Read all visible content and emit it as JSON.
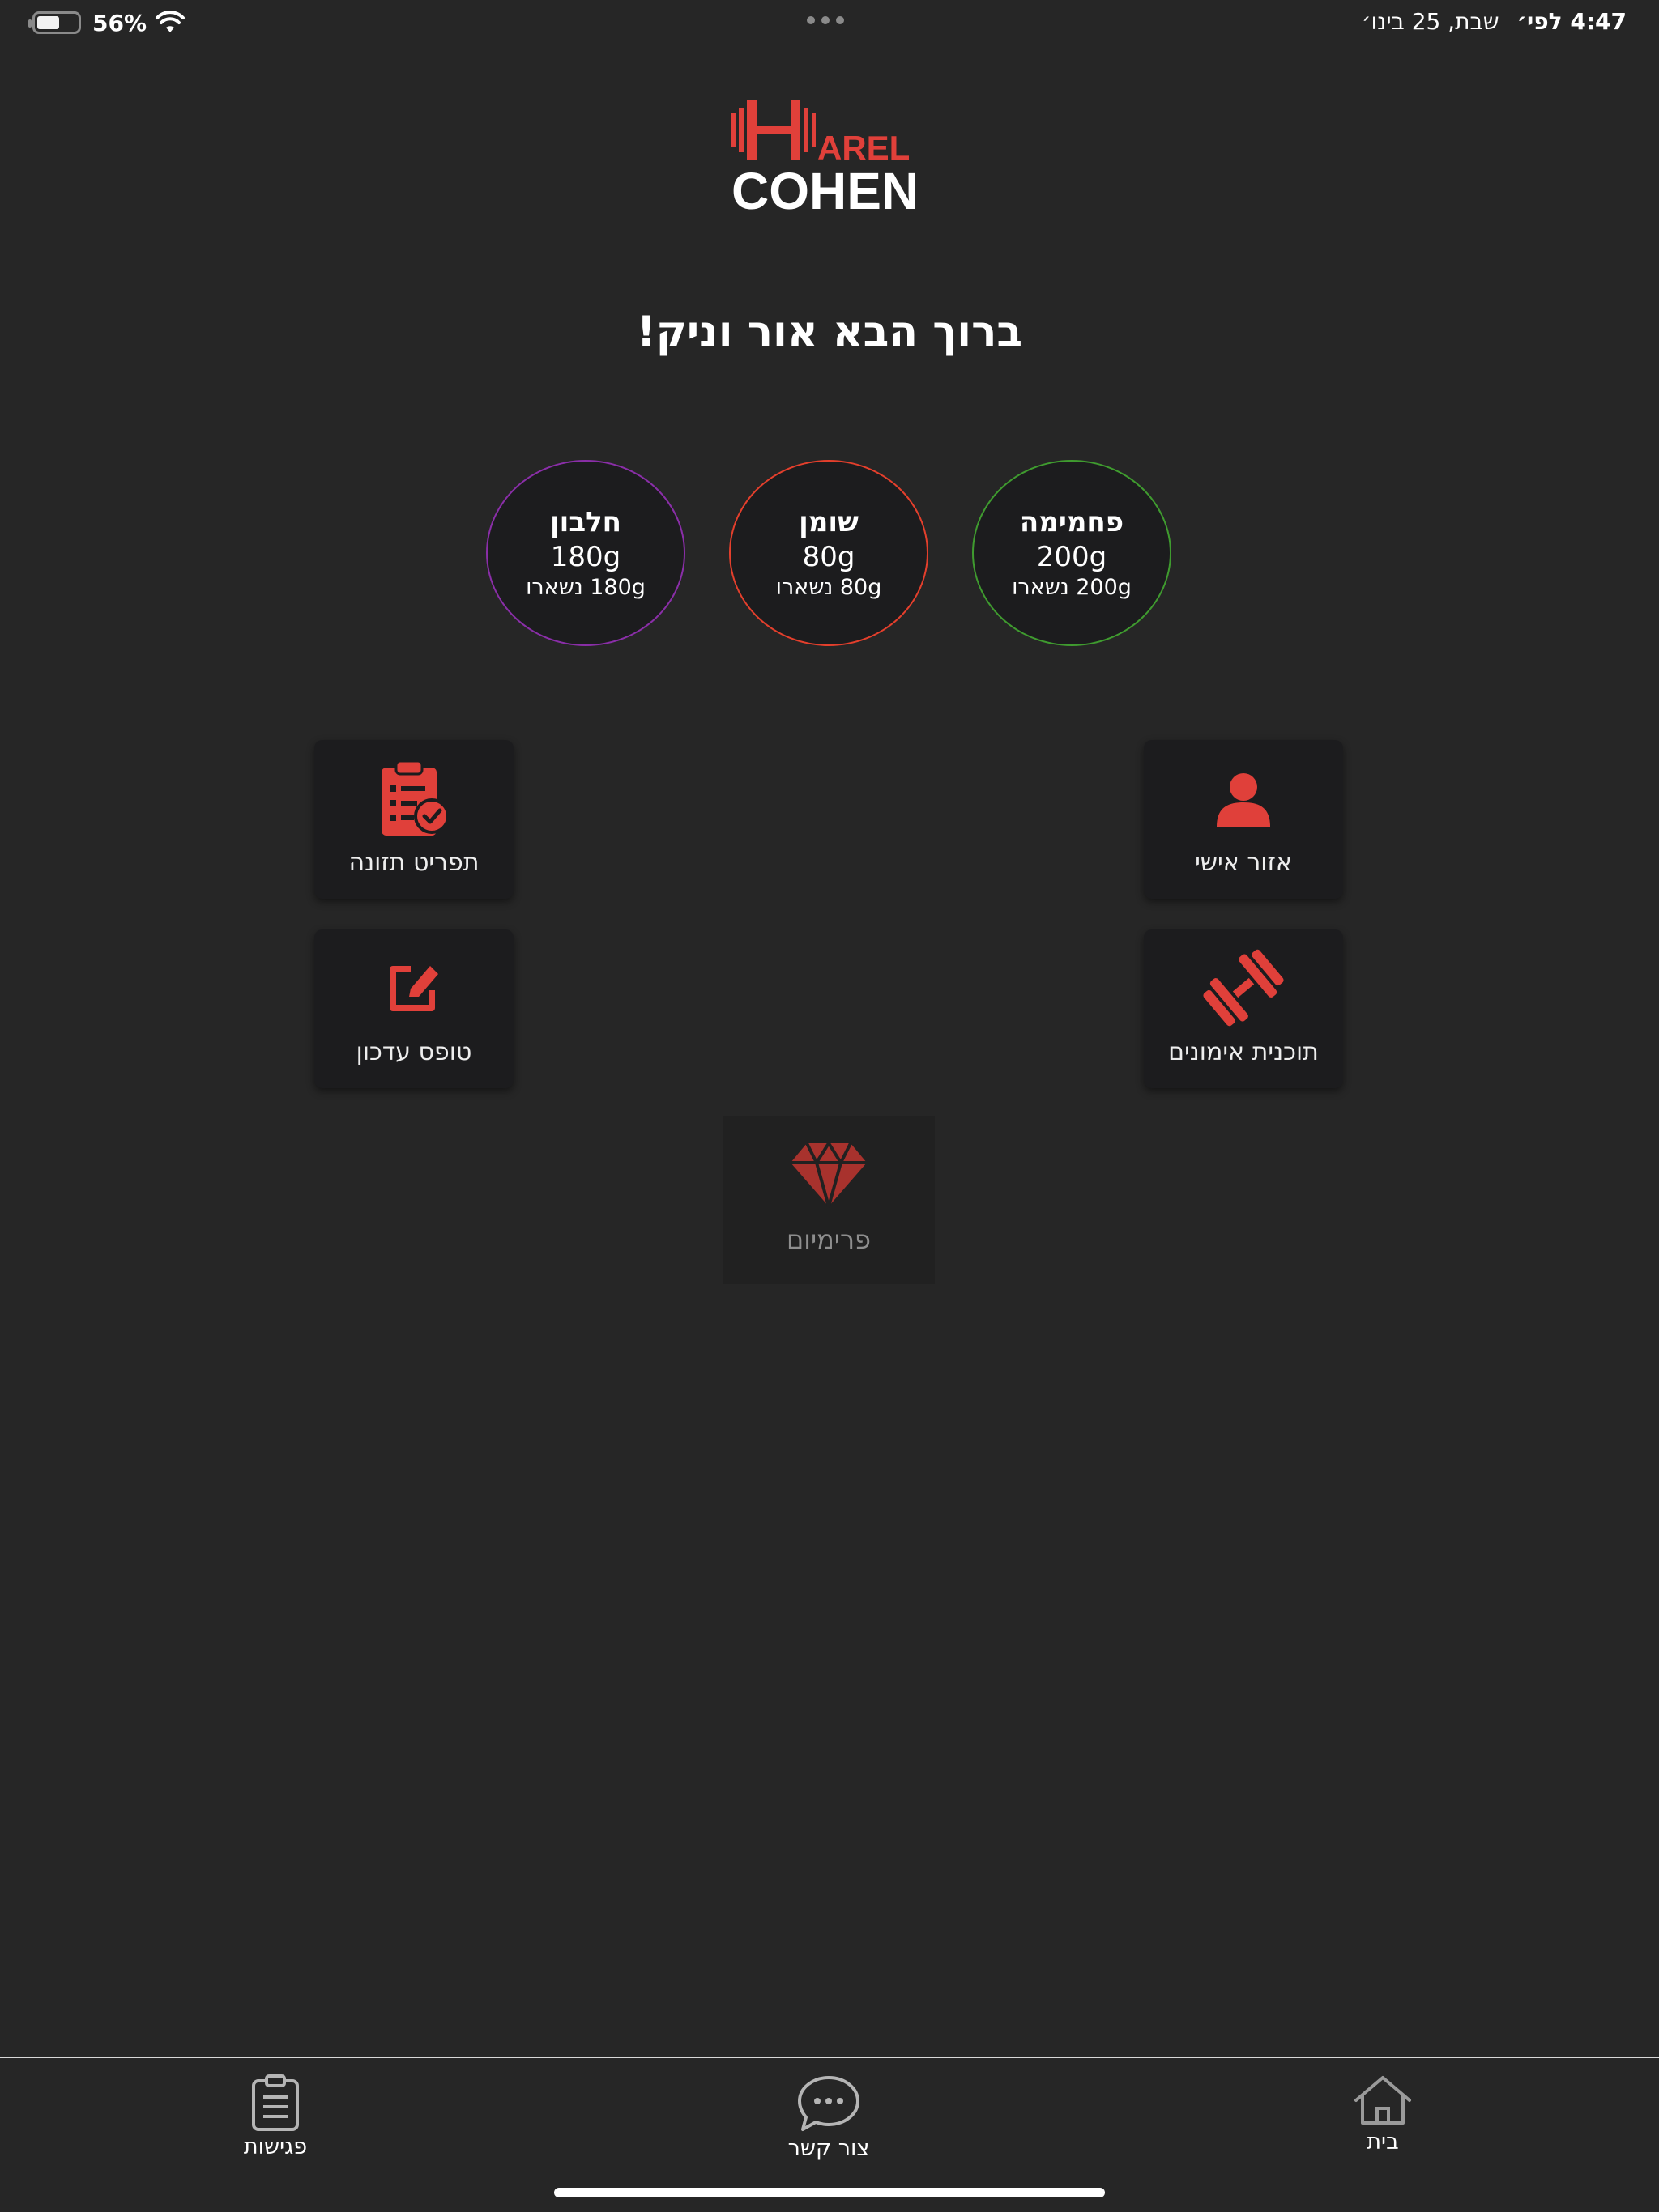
{
  "status_bar": {
    "battery_percent": "56%",
    "battery_level": 0.56,
    "time": "4:47 לפי׳",
    "date": "שבת, 25 בינו׳"
  },
  "logo": {
    "line1": "AREL",
    "line2": "COHEN",
    "accent_color": "#e0403a"
  },
  "welcome": "ברוך הבא אור וניק!",
  "macros": [
    {
      "label": "פחמימה",
      "value": "200g",
      "remaining": "200g נשארו",
      "color": "#3f9b2f"
    },
    {
      "label": "שומן",
      "value": "80g",
      "remaining": "80g נשארו",
      "color": "#e43f2c"
    },
    {
      "label": "חלבון",
      "value": "180g",
      "remaining": "180g נשארו",
      "color": "#8a2ea8"
    }
  ],
  "tiles": {
    "personal_area": {
      "label": "אזור אישי",
      "icon": "person-icon"
    },
    "nutrition_menu": {
      "label": "תפריט תזונה",
      "icon": "clipboard-check-icon"
    },
    "training_plan": {
      "label": "תוכנית אימונים",
      "icon": "dumbbell-icon"
    },
    "update_form": {
      "label": "טופס עדכון",
      "icon": "edit-icon"
    },
    "premium": {
      "label": "פרימיום",
      "icon": "diamond-icon"
    }
  },
  "tabbar": {
    "home": {
      "label": "בית",
      "icon": "home-icon"
    },
    "contact": {
      "label": "צור קשר",
      "icon": "chat-icon"
    },
    "meetings": {
      "label": "פגישות",
      "icon": "clipboard-list-icon"
    }
  },
  "colors": {
    "background": "#262626",
    "tile_background": "#1c1c1e",
    "accent": "#e0403a"
  }
}
